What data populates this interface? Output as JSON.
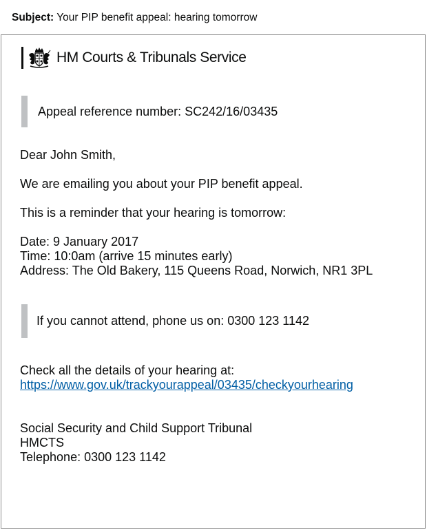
{
  "subject": {
    "label": "Subject:",
    "text": "Your PIP benefit appeal: hearing tomorrow"
  },
  "header": {
    "logo_icon": "royal-crest-icon",
    "org_name": "HM Courts & Tribunals Service"
  },
  "reference": "Appeal reference number: SC242/16/03435",
  "body": {
    "greeting": "Dear John Smith,",
    "intro": "We are emailing you about your PIP benefit appeal.",
    "reminder": "This is a reminder that your hearing is tomorrow:",
    "date": "Date: 9 January 2017",
    "time": "Time: 10:0am (arrive 15 minutes early)",
    "address": "Address: The Old Bakery, 115 Queens Road, Norwich, NR1 3PL",
    "cannot_attend": "If you cannot attend, phone us on: 0300 123 1142",
    "check_details": "Check all the details of your hearing at:",
    "link": "https://www.gov.uk/trackyourappeal/03435/checkyourhearing"
  },
  "signature": {
    "tribunal": "Social Security and Child Support Tribunal",
    "org": "HMCTS",
    "telephone": "Telephone: 0300 123 1142"
  },
  "colors": {
    "link": "#005ea5",
    "inset_border": "#bfc1c3",
    "text": "#0b0c0c"
  }
}
